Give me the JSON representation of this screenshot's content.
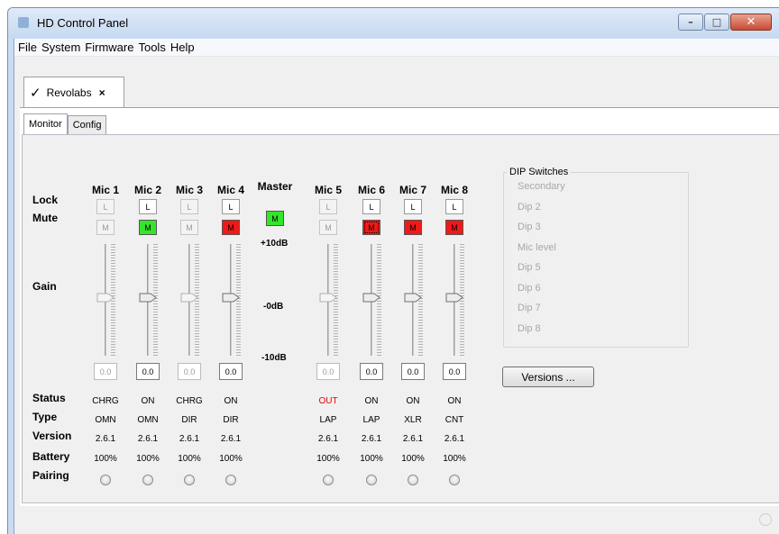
{
  "window": {
    "title": "HD Control Panel"
  },
  "menu": [
    "File",
    "System",
    "Firmware",
    "Tools",
    "Help"
  ],
  "doc_tab": {
    "label": "Revolabs",
    "close": "×"
  },
  "subtabs": [
    "Monitor",
    "Config"
  ],
  "row_labels": {
    "lock": "Lock",
    "mute": "Mute",
    "gain": "Gain",
    "status": "Status",
    "type": "Type",
    "version": "Version",
    "battery": "Battery",
    "pairing": "Pairing"
  },
  "master": {
    "label": "Master",
    "mute": "M",
    "gain_top": "+10dB",
    "gain_mid": "-0dB",
    "gain_bot": "-10dB"
  },
  "mics": [
    {
      "name": "Mic 1",
      "lock": "L",
      "mute": "M",
      "gain": "0.0",
      "status": "CHRG",
      "type": "OMN",
      "version": "2.6.1",
      "battery": "100%"
    },
    {
      "name": "Mic 2",
      "lock": "L",
      "mute": "M",
      "gain": "0.0",
      "status": "ON",
      "type": "OMN",
      "version": "2.6.1",
      "battery": "100%"
    },
    {
      "name": "Mic 3",
      "lock": "L",
      "mute": "M",
      "gain": "0.0",
      "status": "CHRG",
      "type": "DIR",
      "version": "2.6.1",
      "battery": "100%"
    },
    {
      "name": "Mic 4",
      "lock": "L",
      "mute": "M",
      "gain": "0.0",
      "status": "ON",
      "type": "DIR",
      "version": "2.6.1",
      "battery": "100%"
    },
    {
      "name": "Mic 5",
      "lock": "L",
      "mute": "M",
      "gain": "0.0",
      "status": "OUT",
      "type": "LAP",
      "version": "2.6.1",
      "battery": "100%"
    },
    {
      "name": "Mic 6",
      "lock": "L",
      "mute": "M",
      "gain": "0.0",
      "status": "ON",
      "type": "LAP",
      "version": "2.6.1",
      "battery": "100%"
    },
    {
      "name": "Mic 7",
      "lock": "L",
      "mute": "M",
      "gain": "0.0",
      "status": "ON",
      "type": "XLR",
      "version": "2.6.1",
      "battery": "100%"
    },
    {
      "name": "Mic 8",
      "lock": "L",
      "mute": "M",
      "gain": "0.0",
      "status": "ON",
      "type": "CNT",
      "version": "2.6.1",
      "battery": "100%"
    }
  ],
  "dip_switches": {
    "title": "DIP Switches",
    "items": [
      "Secondary",
      "Dip 2",
      "Dip 3",
      "Mic level",
      "Dip 5",
      "Dip 6",
      "Dip 7",
      "Dip 8"
    ]
  },
  "versions_button": "Versions ...",
  "colors": {
    "mute_on": "#33e62b",
    "mute_active": "#f21818",
    "status_out": "#e60000"
  }
}
